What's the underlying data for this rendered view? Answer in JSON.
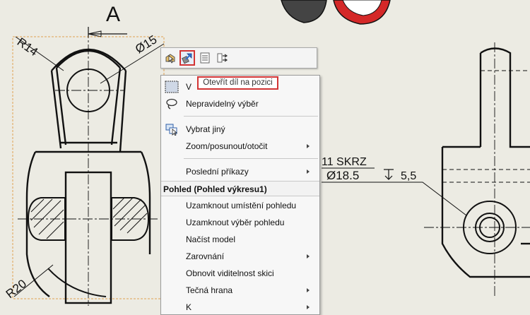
{
  "drawing": {
    "section_letter": "A",
    "dims": {
      "r14": "R14",
      "phi15": "Ø15",
      "r20": "R20",
      "hole_count": "11 SKRZ",
      "hole_diameter": "Ø18.5",
      "hole_depth": "5,5"
    }
  },
  "toolbar": {
    "buttons": [
      {
        "name": "select-part-icon",
        "active": false
      },
      {
        "name": "open-part-icon",
        "active": true
      },
      {
        "name": "properties-icon",
        "active": false
      },
      {
        "name": "rebuild-icon",
        "active": false
      }
    ]
  },
  "tooltip": {
    "text": "Otevřít díl na pozici"
  },
  "menu": {
    "items": [
      {
        "label": "V",
        "icon": "select-box-icon",
        "submenu": false
      },
      {
        "label": "Nepravidelný výběr",
        "icon": "lasso-icon",
        "submenu": false
      },
      {
        "label": "Vybrat jiný",
        "icon": "select-other-icon",
        "submenu": false
      },
      {
        "label": "Zoom/posunout/otočit",
        "icon": "",
        "submenu": true
      },
      {
        "label": "Poslední příkazy",
        "icon": "",
        "submenu": true
      },
      {
        "label": "Uzamknout umístění pohledu",
        "icon": "",
        "submenu": false
      },
      {
        "label": "Uzamknout výběr pohledu",
        "icon": "",
        "submenu": false
      },
      {
        "label": "Načíst model",
        "icon": "",
        "submenu": false
      },
      {
        "label": "Zarovnání",
        "icon": "",
        "submenu": true
      },
      {
        "label": "Obnovit viditelnost skici",
        "icon": "",
        "submenu": false
      },
      {
        "label": "Tečná hrana",
        "icon": "",
        "submenu": true
      },
      {
        "label": "K",
        "icon": "",
        "submenu": true
      }
    ],
    "section_header": "Pohled (Pohled výkresu1)"
  },
  "colors": {
    "highlight": "#d23434",
    "background": "#ecebe3"
  }
}
